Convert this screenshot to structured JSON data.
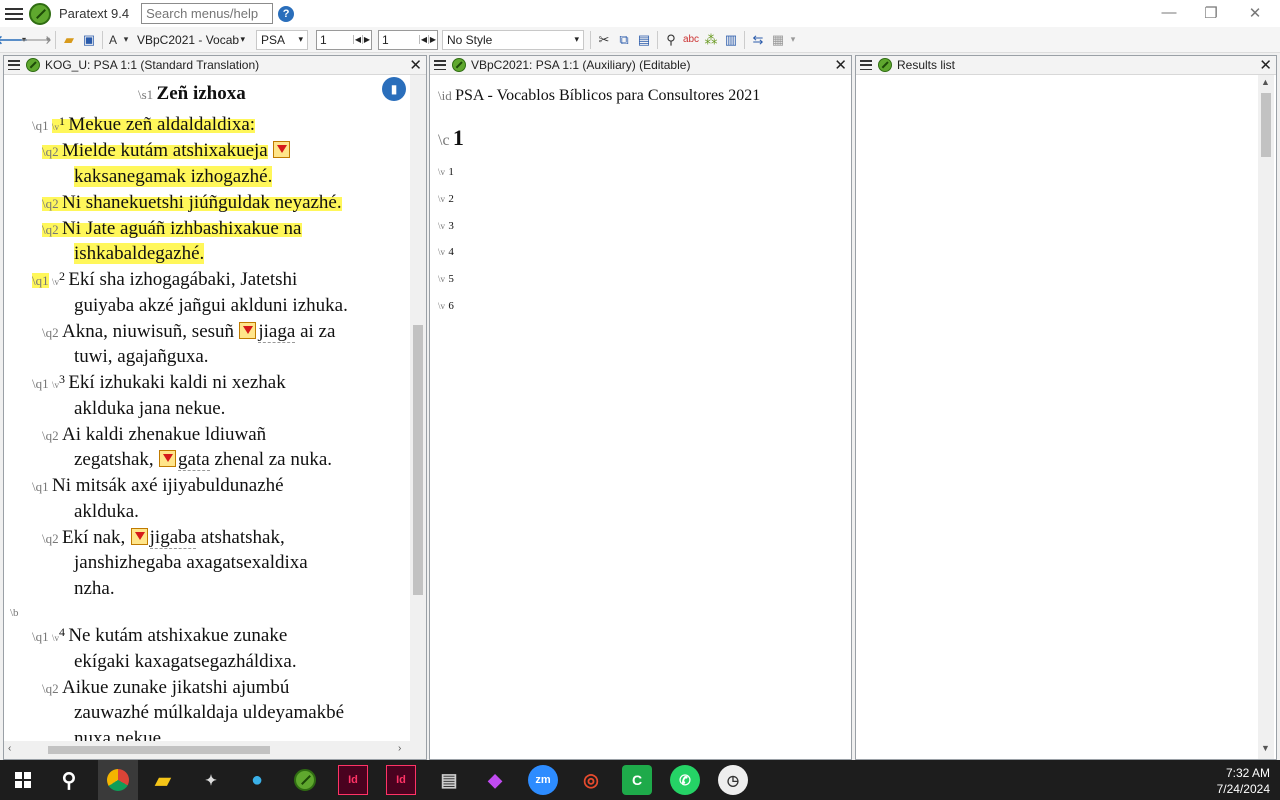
{
  "app": {
    "title": "Paratext 9.4",
    "search_placeholder": "Search menus/help",
    "help": "?"
  },
  "window_controls": {
    "minimize": "—",
    "restore": "❐",
    "close": "✕"
  },
  "toolbar": {
    "back": "🡐",
    "forward": "🡒",
    "font": "A",
    "project": "VBpC2021 - Vocab",
    "book": "PSA",
    "chapter": "1",
    "verse": "1",
    "style": "No Style"
  },
  "pane1": {
    "title": "KOG_U: PSA 1:1 (Standard Translation)",
    "close": "✕",
    "s1_marker": "\\s1",
    "heading": "Zeñ izhoxa",
    "lines": {
      "l1": {
        "marker": "\\q1",
        "vmarker": "\\v",
        "vnum": "1",
        "text": "Mekue zeñ aldaldaldixa:"
      },
      "l2": {
        "marker": "\\q2",
        "text": "Mielde kutám atshixakueja"
      },
      "l3": {
        "text": "kaksanegamak izhogazhé."
      },
      "l4": {
        "marker": "\\q2",
        "text": "Ni shanekuetshi jiúñguldak neyazhé."
      },
      "l5": {
        "marker": "\\q2",
        "text": "Ni Jate aguáñ izhbashixakue na"
      },
      "l6": {
        "text": "ishkabaldegazhé."
      },
      "l7": {
        "marker": "\\q1",
        "vmarker": "\\v",
        "vnum": "2",
        "text": "Ekí sha izhogagábaki, Jatetshi"
      },
      "l8": {
        "text": "guiyaba akzé jañgui aklduni izhuka."
      },
      "l9": {
        "marker": "\\q2",
        "text_a": "Akna, niuwisuñ, sesuñ",
        "text_b": "jiaga",
        "text_c": " ai za"
      },
      "l10": {
        "text": "tuwi, agajañguxa."
      },
      "l11": {
        "marker": "\\q1",
        "vmarker": "\\v",
        "vnum": "3",
        "text": "Ekí izhukaki kaldi ni xezhak"
      },
      "l12": {
        "text": "aklduka jana nekue."
      },
      "l13": {
        "marker": "\\q2",
        "text": "Ai kaldi zhenakue ldiuwañ"
      },
      "l14": {
        "text_a": "zegatshak,",
        "text_b": "gata",
        "text_c": " zhenal za nuka."
      },
      "l15": {
        "marker": "\\q1",
        "text": "Ni mitsák axé ijiyabuldunazhé"
      },
      "l16": {
        "text": "aklduka."
      },
      "l17": {
        "marker": "\\q2",
        "text_a": "Ekí nak,",
        "text_b": "jigaba",
        "text_c": " atshatshak,"
      },
      "l18": {
        "text": "janshizhegaba axagatsexaldixa"
      },
      "l19": {
        "text": "nzha."
      },
      "b": {
        "marker": "\\b"
      },
      "l20": {
        "marker": "\\q1",
        "vmarker": "\\v",
        "vnum": "4",
        "text": "Ne kutám atshixakue zunake"
      },
      "l21": {
        "text": "ekígaki kaxagatsegazháldixa."
      },
      "l22": {
        "marker": "\\q2",
        "text": "Aikue zunake jikatshi ajumbú"
      },
      "l23": {
        "text": "zauwazhé múlkaldaja uldeyamakbé"
      },
      "l24": {
        "text": "nuxa nekue."
      }
    }
  },
  "pane2": {
    "title": "VBpC2021: PSA 1:1 (Auxiliary) (Editable)",
    "close": "✕",
    "id_marker": "\\id",
    "id_text": "PSA - Vocablos Bíblicos para Consultores 2021",
    "c_marker": "\\c",
    "chapter": "1",
    "v_marker": "\\v",
    "verses": [
      "1",
      "2",
      "3",
      "4",
      "5",
      "6"
    ]
  },
  "pane3": {
    "title": "Results list",
    "close": "✕"
  },
  "taskbar": {
    "time": "7:32 AM",
    "date": "7/24/2024"
  },
  "colors": {
    "highlight": "#fff75a",
    "accent": "#2a6ebb",
    "logo": "#5fa82e"
  }
}
